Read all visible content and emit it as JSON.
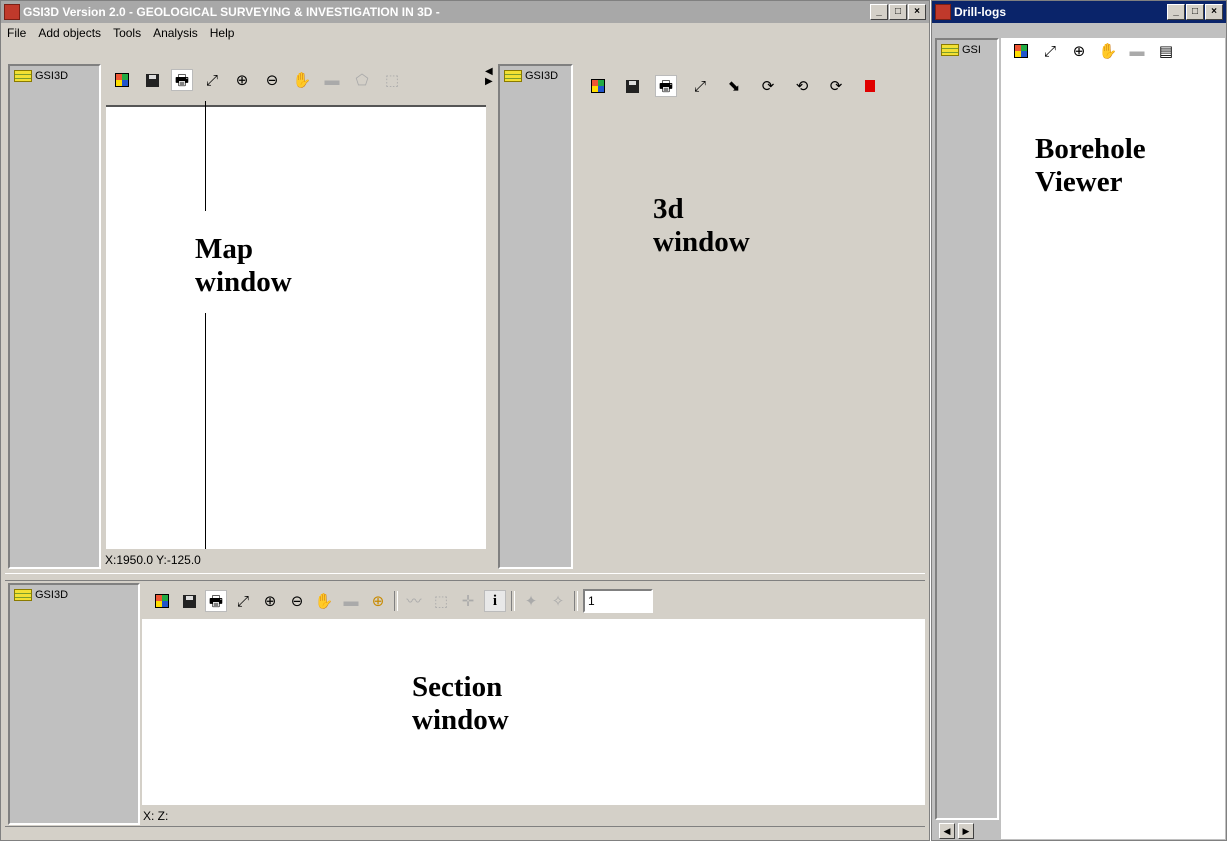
{
  "main_window": {
    "title": "GSI3D Version 2.0  -  GEOLOGICAL SURVEYING & INVESTIGATION IN 3D -",
    "controls": {
      "minimize": "_",
      "maximize": "□",
      "close": "×"
    },
    "menu": [
      "File",
      "Add objects",
      "Tools",
      "Analysis",
      "Help"
    ]
  },
  "map_pane": {
    "tree_label": "GSI3D",
    "status": "X:1950.0 Y:-125.0",
    "annotation": [
      "Map",
      "window"
    ]
  },
  "view3d_pane": {
    "tree_label": "GSI3D",
    "annotation": [
      "3d",
      "window"
    ]
  },
  "section_pane": {
    "tree_label": "GSI3D",
    "status": "X:  Z:",
    "number_field": "1",
    "annotation": [
      "Section",
      "window"
    ]
  },
  "drill_logs_window": {
    "title": "Drill-logs",
    "tree_label": "GSI",
    "annotation": [
      "Borehole",
      "Viewer"
    ]
  },
  "icons": {
    "colors": "▦",
    "save": "▪",
    "print": "🖶",
    "zoom_extent": "⤢",
    "zoom_in": "⊕",
    "zoom_out": "⊖",
    "pan": "✋",
    "measure": "▬",
    "polygon": "⬠",
    "select": "⬚",
    "arrow_left": "◀",
    "arrow_right": "▶",
    "drill": "⬊",
    "pick": "⟳",
    "rotate_left": "⟲",
    "rotate_right": "⟳",
    "stop": "■",
    "zoom_box": "⊕",
    "line": "〰",
    "node_select": "⬚",
    "node_move": "✛",
    "info": "i",
    "add_point": "✦",
    "del_point": "✧",
    "table": "▤",
    "scroll_left": "◀",
    "scroll_right": "▶"
  },
  "colors": {
    "title_inactive": "#a8a8a8",
    "chrome": "#d4d0c8",
    "tree_bg": "#c0c0c0",
    "stop_red": "#e00000"
  }
}
